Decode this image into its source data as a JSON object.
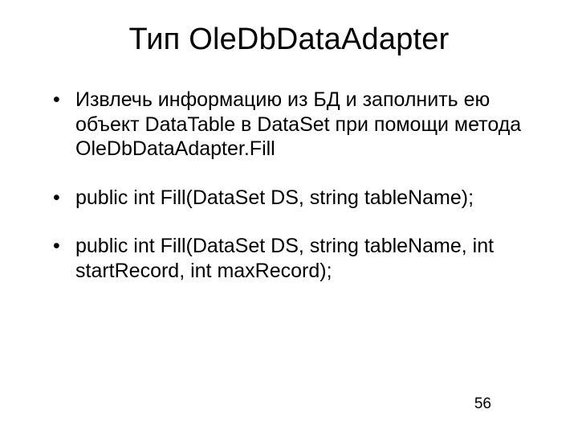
{
  "title": "Тип OleDbDataAdapter",
  "bullets": [
    "Извлечь информацию из БД и заполнить ею объект DataTable в DataSet при помощи метода OleDbDataAdapter.Fill",
    "public int Fill(DataSet DS, string tableName);",
    "public int Fill(DataSet DS, string tableName, int startRecord, int maxRecord);"
  ],
  "page_number": "56"
}
